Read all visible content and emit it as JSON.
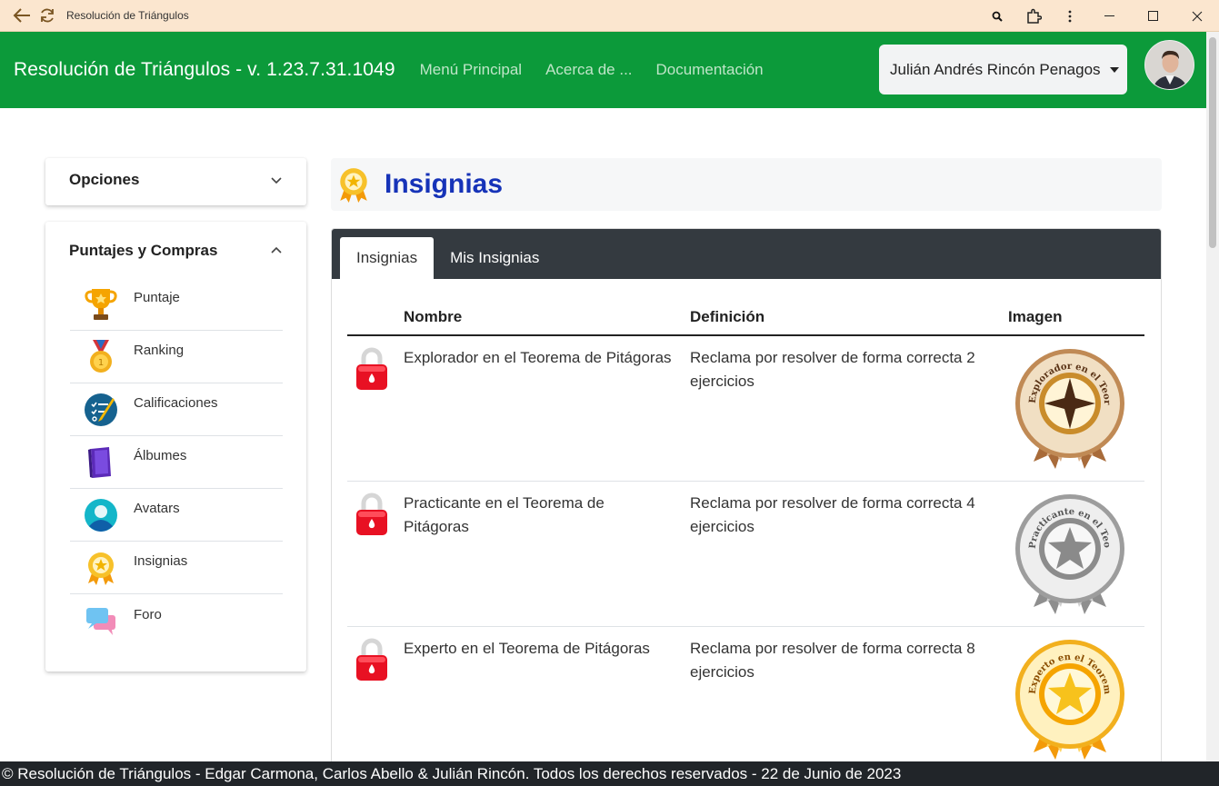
{
  "window": {
    "title": "Resolución de Triángulos"
  },
  "navbar": {
    "brand": "Resolución de Triángulos - v. 1.23.7.31.1049",
    "links": [
      "Menú Principal",
      "Acerca de ...",
      "Documentación"
    ],
    "user_name": "Julián Andrés Rincón Penagos"
  },
  "sidebar": {
    "options_title": "Opciones",
    "scores_title": "Puntajes y Compras",
    "items": [
      {
        "label": "Puntaje",
        "icon": "trophy-icon"
      },
      {
        "label": "Ranking",
        "icon": "medal-icon"
      },
      {
        "label": "Calificaciones",
        "icon": "grades-icon"
      },
      {
        "label": "Álbumes",
        "icon": "album-icon"
      },
      {
        "label": "Avatars",
        "icon": "avatar-icon"
      },
      {
        "label": "Insignias",
        "icon": "badge-icon"
      },
      {
        "label": "Foro",
        "icon": "forum-icon"
      }
    ]
  },
  "main": {
    "title": "Insignias",
    "tabs": [
      "Insignias",
      "Mis Insignias"
    ],
    "active_tab": "Insignias",
    "table": {
      "headers": [
        "Nombre",
        "Definición",
        "Imagen"
      ],
      "rows": [
        {
          "name": "Explorador en el Teorema de Pitágoras",
          "definition": "Reclama por resolver de forma correcta 2 ejercicios",
          "badge_text": "Explorador en el Teorema de Pitágoras",
          "level": "bronze"
        },
        {
          "name": "Practicante en el Teorema de Pitágoras",
          "definition": "Reclama por resolver de forma correcta 4 ejercicios",
          "badge_text": "Practicante en el Teorema de Pitágoras",
          "level": "silver"
        },
        {
          "name": "Experto en el Teorema de Pitágoras",
          "definition": "Reclama por resolver de forma correcta 8 ejercicios",
          "badge_text": "Experto en el Teorema de Pitágoras",
          "level": "gold"
        }
      ]
    }
  },
  "footer": {
    "text": "© Resolución de Triángulos - Edgar Carmona, Carlos Abello & Julián Rincón. Todos los derechos reservados - 22 de Junio de 2023"
  },
  "colors": {
    "navbar": "#0c9a3a",
    "title": "#1633b8",
    "tabbar": "#343a40",
    "footer": "#212529",
    "lock": "#e81123"
  }
}
